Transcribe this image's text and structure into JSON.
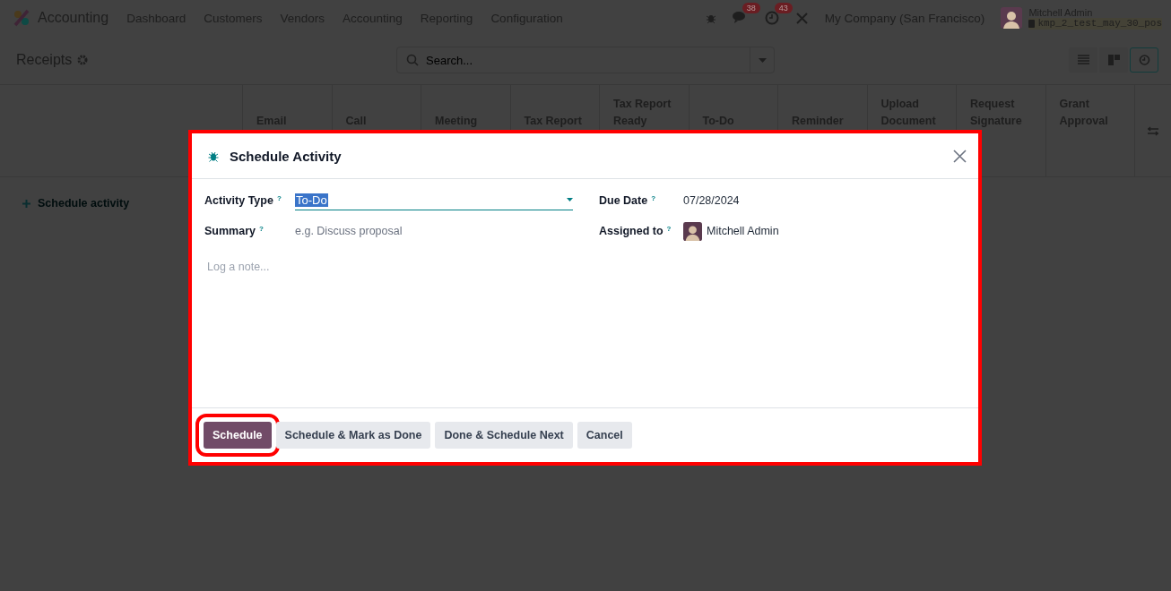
{
  "navbar": {
    "app_name": "Accounting",
    "menu": [
      "Dashboard",
      "Customers",
      "Vendors",
      "Accounting",
      "Reporting",
      "Configuration"
    ],
    "chat_count": "38",
    "activity_count": "43",
    "company": "My Company (San Francisco)",
    "user_name": "Mitchell Admin",
    "database": "kmp_2_test_may_30_pos"
  },
  "control_panel": {
    "title": "Receipts",
    "search": {
      "placeholder": "Search..."
    },
    "views": [
      {
        "kind": "list",
        "selected": false
      },
      {
        "kind": "kanban",
        "selected": false
      },
      {
        "kind": "activity",
        "selected": true
      }
    ]
  },
  "activity_grid": {
    "columns": [
      "Email",
      "Call",
      "Meeting",
      "Tax Report",
      "Tax Report Ready",
      "To-Do",
      "Reminder",
      "Upload Document",
      "Request Signature",
      "Grant Approval"
    ],
    "add_label": "Schedule activity"
  },
  "dialog": {
    "title": "Schedule Activity",
    "highlighted": true,
    "fields": [
      {
        "kind": "select",
        "label": "Activity Type",
        "help": "?",
        "value": "To-Do"
      },
      {
        "kind": "date",
        "label": "Due Date",
        "help": "?",
        "value": "07/28/2024"
      },
      {
        "kind": "text",
        "label": "Summary",
        "help": "?",
        "placeholder": "e.g. Discuss proposal"
      },
      {
        "kind": "user",
        "label": "Assigned to",
        "help": "?",
        "value": "Mitchell Admin"
      }
    ],
    "note_placeholder": "Log a note...",
    "buttons": [
      {
        "label": "Schedule",
        "primary": true,
        "highlighted": true
      },
      {
        "label": "Schedule & Mark as Done",
        "primary": false,
        "highlighted": false
      },
      {
        "label": "Done & Schedule Next",
        "primary": false,
        "highlighted": false
      },
      {
        "label": "Cancel",
        "primary": false,
        "highlighted": false
      }
    ]
  }
}
